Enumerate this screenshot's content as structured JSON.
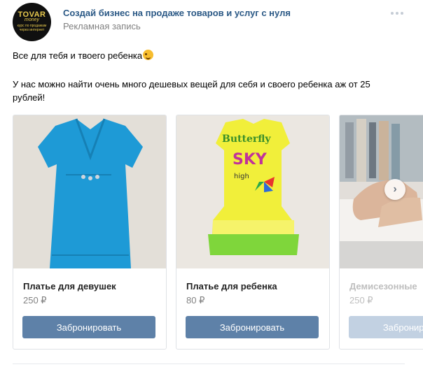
{
  "header": {
    "avatar_logo": "TOVAR",
    "avatar_logo_sub": "money",
    "avatar_tagline": "курс по продажам через интернет",
    "title": "Создай бизнес на продаже товаров и услуг с нуля",
    "subtitle": "Рекламная запись",
    "more_icon": "ellipsis-icon"
  },
  "post": {
    "text_line1": "Все для тебя и твоего ребенка",
    "emoji": "wink-emoji",
    "text_line2": "У нас можно найти очень много дешевых вещей для себя и своего ребенка аж от 25 рублей!"
  },
  "carousel": {
    "items": [
      {
        "name": "Платье для девушек",
        "price": "250 ₽",
        "button": "Забронировать"
      },
      {
        "name": "Платье для ребенка",
        "price": "80 ₽",
        "button": "Забронировать"
      },
      {
        "name": "Демисезонные",
        "price": "250 ₽",
        "button": "Забронировать"
      }
    ],
    "next_icon": "chevron-right-icon"
  },
  "colors": {
    "link": "#2a5885",
    "button": "#5e81a8",
    "muted": "#828282"
  }
}
